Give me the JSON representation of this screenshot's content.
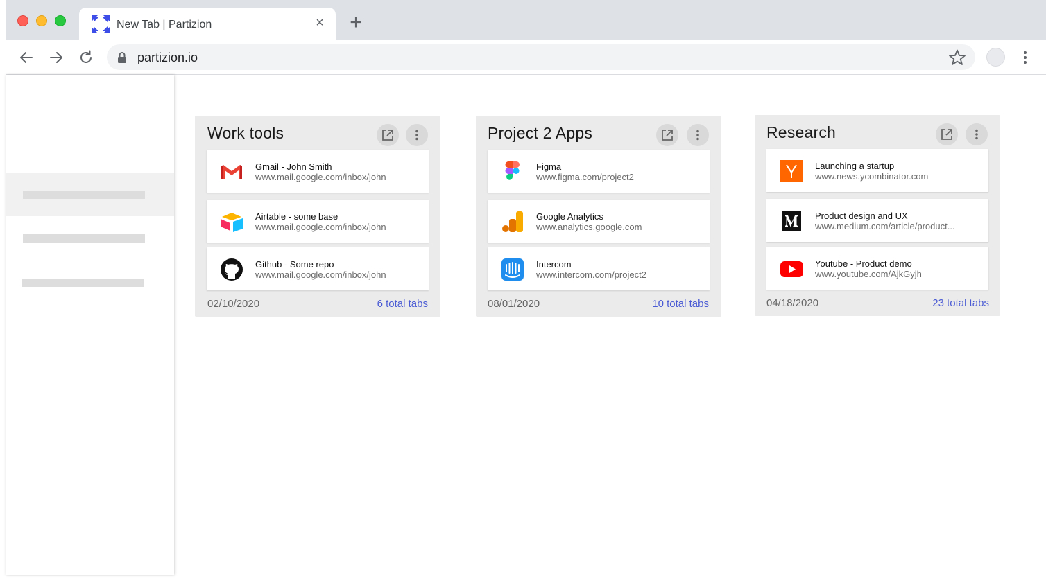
{
  "browser": {
    "tab_title": "New Tab | Partizion",
    "tab_close": "×",
    "new_tab": "+",
    "url": "partizion.io"
  },
  "groups": [
    {
      "title": "Work tools",
      "date": "02/10/2020",
      "count": "6 total tabs",
      "tabs": [
        {
          "title": "Gmail - John Smith",
          "url": "www.mail.google.com/inbox/john",
          "icon": "gmail-icon"
        },
        {
          "title": "Airtable - some base",
          "url": "www.mail.google.com/inbox/john",
          "icon": "airtable-icon"
        },
        {
          "title": "Github - Some repo",
          "url": "www.mail.google.com/inbox/john",
          "icon": "github-icon"
        }
      ]
    },
    {
      "title": "Project 2 Apps",
      "date": "08/01/2020",
      "count": "10 total tabs",
      "tabs": [
        {
          "title": "Figma",
          "url": "www.figma.com/project2",
          "icon": "figma-icon"
        },
        {
          "title": "Google Analytics",
          "url": "www.analytics.google.com",
          "icon": "google-analytics-icon"
        },
        {
          "title": "Intercom",
          "url": "www.intercom.com/project2",
          "icon": "intercom-icon"
        }
      ]
    },
    {
      "title": "Research",
      "date": "04/18/2020",
      "count": "23 total tabs",
      "tabs": [
        {
          "title": "Launching a startup",
          "url": "www.news.ycombinator.com",
          "icon": "ycombinator-icon"
        },
        {
          "title": "Product design and UX",
          "url": "www.medium.com/article/product...",
          "icon": "medium-icon"
        },
        {
          "title": "Youtube - Product demo",
          "url": "www.youtube.com/AjkGyjh",
          "icon": "youtube-icon"
        }
      ]
    }
  ],
  "colors": {
    "accent": "#4a5bd4",
    "group_bg": "#ebebeb",
    "brand": "#3d4ee8"
  }
}
